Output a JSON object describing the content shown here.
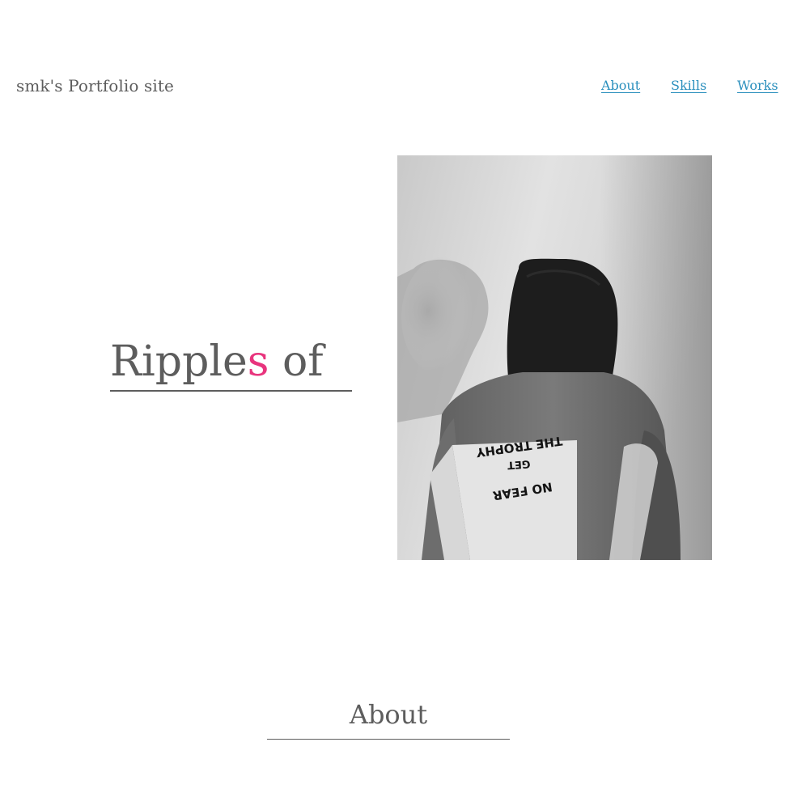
{
  "header": {
    "site_title": "smk's Portfolio site"
  },
  "nav": {
    "items": [
      "About",
      "Skills",
      "Works"
    ]
  },
  "hero": {
    "text_before": "Ripple",
    "text_accent": "s",
    "text_after": " of",
    "accent_color": "#e8347d"
  },
  "photo": {
    "jacket_text_line1": "THE TROPHY",
    "jacket_text_line2": "GET",
    "jacket_text_line3": "NO FEAR"
  },
  "about": {
    "heading": "About"
  },
  "colors": {
    "text": "#5d5d5d",
    "link": "#2a8fbd",
    "accent": "#e8347d"
  }
}
